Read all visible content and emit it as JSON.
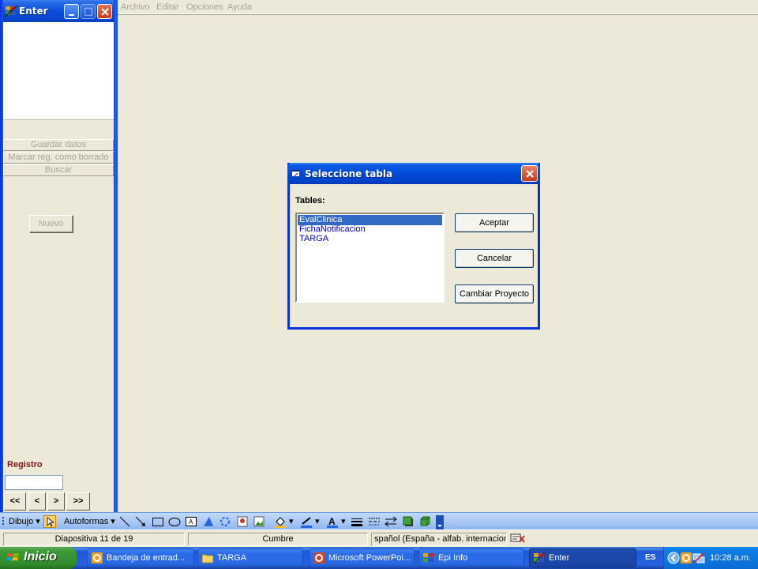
{
  "left_window": {
    "title": "Enter",
    "buttons": {
      "guardar": "Guardar datos",
      "marcar": "Marcar reg. como borrado",
      "buscar": "Buscar",
      "nuevo": "Nuevo"
    },
    "registro_label": "Registro",
    "registro_value": "",
    "nav": {
      "first": "<<",
      "prev": "<",
      "next": ">",
      "last": ">>"
    }
  },
  "menubar": {
    "items": [
      "Archivo",
      "Editar",
      "Opciones",
      "Ayuda"
    ]
  },
  "dialog": {
    "title": "Seleccione tabla",
    "tables_label": "Tables:",
    "tables": [
      "EvalClinica",
      "FichaNotificacion",
      "TARGA"
    ],
    "selected_index": 0,
    "buttons": {
      "aceptar": "Aceptar",
      "cancelar": "Cancelar",
      "cambiar": "Cambiar Proyecto"
    }
  },
  "draw_toolbar": {
    "dibujo": "Dibujo",
    "autoformas": "Autoformas"
  },
  "statusbar": {
    "slide": "Diapositiva 11 de 19",
    "design": "Cumbre",
    "language": "spañol (España - alfab. internacional"
  },
  "taskbar": {
    "start": "Inicio",
    "tasks": [
      {
        "label": "Bandeja de entrad...",
        "icon": "outlook-icon"
      },
      {
        "label": "TARGA",
        "icon": "folder-icon"
      },
      {
        "label": "Microsoft PowerPoi...",
        "icon": "powerpoint-icon"
      },
      {
        "label": "Epi Info",
        "icon": "epiinfo-icon"
      },
      {
        "label": "Enter",
        "icon": "epiinfo-enter-icon",
        "active": true
      }
    ],
    "lang": "ES",
    "clock": "10:28 a.m."
  },
  "colors": {
    "xp_blue": "#0831d9",
    "title_blue": "#0a4fd8",
    "selection": "#316ac5",
    "list_text": "#0000cc",
    "registro": "#7a1818",
    "start_green": "#3c9a37"
  }
}
